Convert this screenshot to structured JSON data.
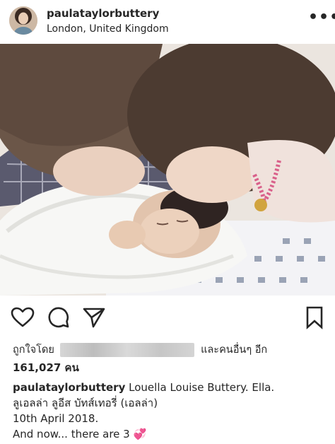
{
  "post": {
    "username": "paulataylorbuttery",
    "location": "London, United Kingdom",
    "more_label": "•••"
  },
  "photo": {
    "description_icon": "photo"
  },
  "actions": {
    "like_icon": "heart-icon",
    "comment_icon": "comment-icon",
    "share_icon": "share-icon",
    "save_icon": "bookmark-icon"
  },
  "likes": {
    "prefix": "ถูกใจโดย",
    "suffix": "และคนอื่นๆ อีก",
    "count": "161,027 คน"
  },
  "caption": {
    "username": "paulataylorbuttery",
    "line1": " Louella Louise Buttery. Ella.",
    "line2": "ลูเอลล่า ลูอีส บัทส์เทอรี่ (เอลล่า)",
    "line3": "10th April 2018.",
    "line4": "And now... there are 3",
    "emoji": "💞"
  }
}
